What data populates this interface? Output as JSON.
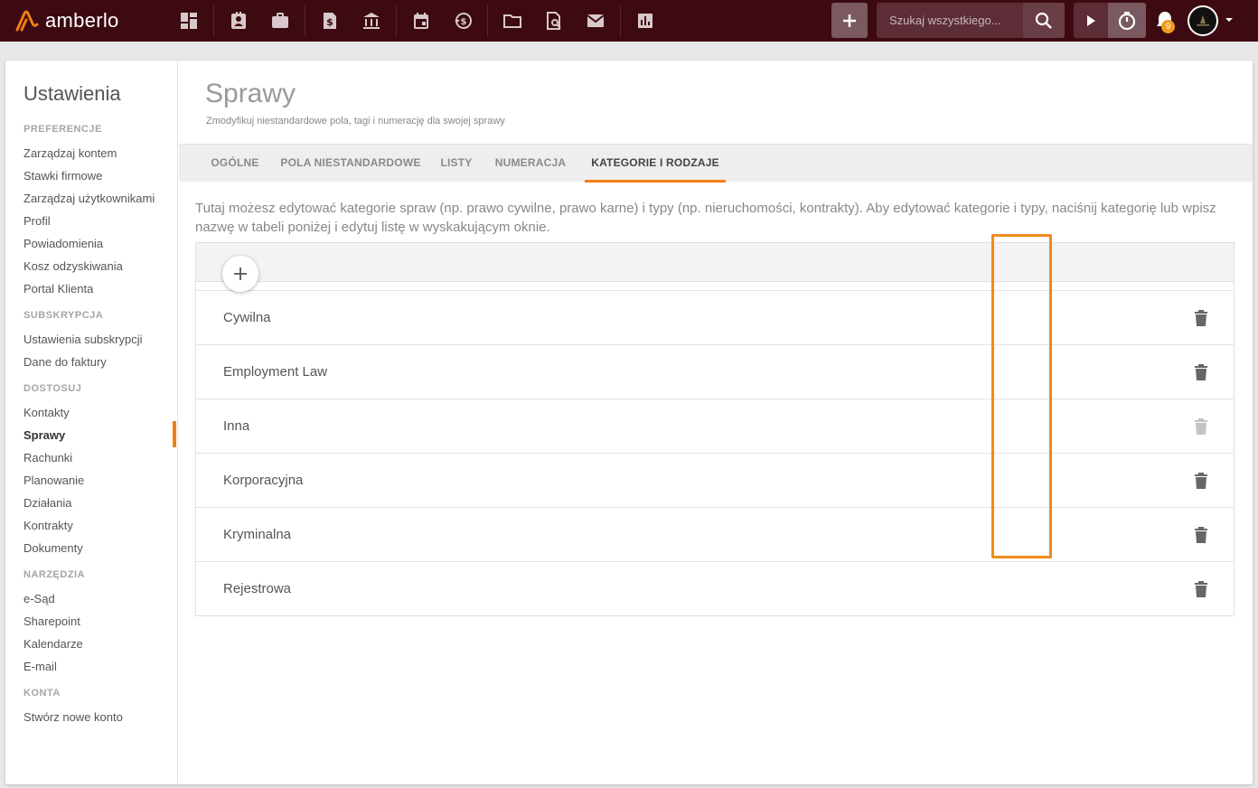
{
  "app": {
    "logo_text": "amberlo",
    "accent": "#f07f13",
    "topbar_color": "#3d0a12"
  },
  "topbar": {
    "nav_icons": [
      "dashboard-icon",
      "contacts-icon",
      "briefcase-icon",
      "invoice-icon",
      "bank-icon",
      "calendar-icon",
      "history-icon",
      "folder-icon",
      "document-search-icon",
      "mail-icon",
      "reports-icon"
    ],
    "search_placeholder": "Szukaj wszystkiego...",
    "notification_count": "9"
  },
  "sidebar": {
    "title": "Ustawienia",
    "sections": [
      {
        "heading": "PREFERENCJE",
        "items": [
          "Zarządzaj kontem",
          "Stawki firmowe",
          "Zarządzaj użytkownikami",
          "Profil",
          "Powiadomienia",
          "Kosz odzyskiwania",
          "Portal Klienta"
        ]
      },
      {
        "heading": "SUBSKRYPCJA",
        "items": [
          "Ustawienia subskrypcji",
          "Dane do faktury"
        ]
      },
      {
        "heading": "DOSTOSUJ",
        "items": [
          "Kontakty",
          "Sprawy",
          "Rachunki",
          "Planowanie",
          "Działania",
          "Kontrakty",
          "Dokumenty"
        ]
      },
      {
        "heading": "NARZĘDZIA",
        "items": [
          "e-Sąd",
          "Sharepoint",
          "Kalendarze",
          "E-mail"
        ]
      },
      {
        "heading": "KONTA",
        "items": [
          "Stwórz nowe konto"
        ]
      }
    ],
    "active_item": "Sprawy"
  },
  "main": {
    "title": "Sprawy",
    "subtitle": "Zmodyfikuj niestandardowe pola, tagi i numerację dla swojej sprawy",
    "tabs": [
      "OGÓLNE",
      "POLA NIESTANDARDOWE",
      "LISTY",
      "NUMERACJA",
      "KATEGORIE I RODZAJE"
    ],
    "active_tab": "KATEGORIE I RODZAJE",
    "description": "Tutaj możesz edytować kategorie spraw (np. prawo cywilne, prawo karne) i typy (np. nieruchomości, kontrakty). Aby edytować kategorie i typy, naciśnij kategorię lub wpisz nazwę w tabeli poniżej i edytuj listę w wyskakującym oknie.",
    "categories": [
      {
        "name": "Cywilna",
        "deletable": true
      },
      {
        "name": "Employment Law",
        "deletable": true
      },
      {
        "name": "Inna",
        "deletable": false
      },
      {
        "name": "Korporacyjna",
        "deletable": true
      },
      {
        "name": "Kryminalna",
        "deletable": true
      },
      {
        "name": "Rejestrowa",
        "deletable": true
      }
    ]
  }
}
